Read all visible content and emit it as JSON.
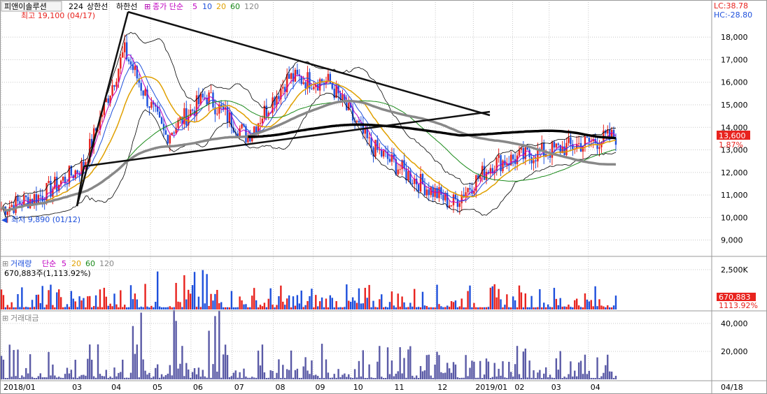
{
  "header": {
    "stock_name": "피앤이솔루션",
    "period": "224",
    "upper_band": "상한선",
    "lower_band": "하한선",
    "price_ma_label": "종가 단순",
    "ma_periods": [
      "5",
      "10",
      "20",
      "60",
      "120"
    ],
    "lc_value": "LC:38.78",
    "hc_value": "HC:-28.80"
  },
  "annotations": {
    "high_label": "최고 19,100 (04/17)",
    "low_label": "최저 9,890 (01/12)"
  },
  "volume_panel": {
    "title": "거래량",
    "ma_label": "단순",
    "ma_periods": [
      "5",
      "20",
      "60",
      "120"
    ],
    "info": "670,883주(1,113.92%)",
    "last_value": "670,883",
    "last_ratio": "1113.92%"
  },
  "amount_panel": {
    "title": "거래대금"
  },
  "price_badge": {
    "value": "13,600",
    "change": "1.87%"
  },
  "colors": {
    "up": "#e8231e",
    "down": "#1e50dc",
    "accent": "#e8231e",
    "hc_color": "#1e50dc",
    "amount_bar": "#5a5aa6",
    "grid": "#c8c8c8"
  },
  "chart_data": [
    {
      "type": "candlestick",
      "price_axis_ticks": [
        "18,000",
        "17,000",
        "16,000",
        "15,000",
        "14,000",
        "13,000",
        "12,000",
        "11,000",
        "10,000",
        "9,000"
      ],
      "ylim": [
        8400,
        19400
      ],
      "x_ticks": [
        "2018/01",
        "03",
        "04",
        "05",
        "06",
        "07",
        "08",
        "09",
        "10",
        "11",
        "12",
        "2019/01",
        "02",
        "03",
        "04"
      ],
      "last_date": "04/18",
      "monthly_close_approx": [
        {
          "date": "2018/01",
          "close": 10400
        },
        {
          "date": "2018/02",
          "close": 11000
        },
        {
          "date": "2018/03",
          "close": 12300
        },
        {
          "date": "2018/04",
          "close": 17400
        },
        {
          "date": "2018/05",
          "close": 13600
        },
        {
          "date": "2018/06",
          "close": 15400
        },
        {
          "date": "2018/07",
          "close": 13600
        },
        {
          "date": "2018/08",
          "close": 16200
        },
        {
          "date": "2018/09",
          "close": 16000
        },
        {
          "date": "2018/10",
          "close": 13200
        },
        {
          "date": "2018/11",
          "close": 11800
        },
        {
          "date": "2018/12",
          "close": 10600
        },
        {
          "date": "2019/01",
          "close": 12400
        },
        {
          "date": "2019/02",
          "close": 12800
        },
        {
          "date": "2019/03",
          "close": 13200
        },
        {
          "date": "2019/04",
          "close": 13600
        }
      ],
      "high": {
        "value": 19100,
        "date": "04/17"
      },
      "low": {
        "value": 9890,
        "date": "01/12"
      },
      "last_close": 13600,
      "last_change_pct": 1.87
    },
    {
      "type": "bar",
      "name_ref": "volume",
      "axis_ticks": [
        "2,500K"
      ],
      "last_value": 670883
    },
    {
      "type": "bar",
      "name_ref": "trading_amount",
      "axis_ticks": [
        "40,000",
        "20,000"
      ]
    }
  ]
}
